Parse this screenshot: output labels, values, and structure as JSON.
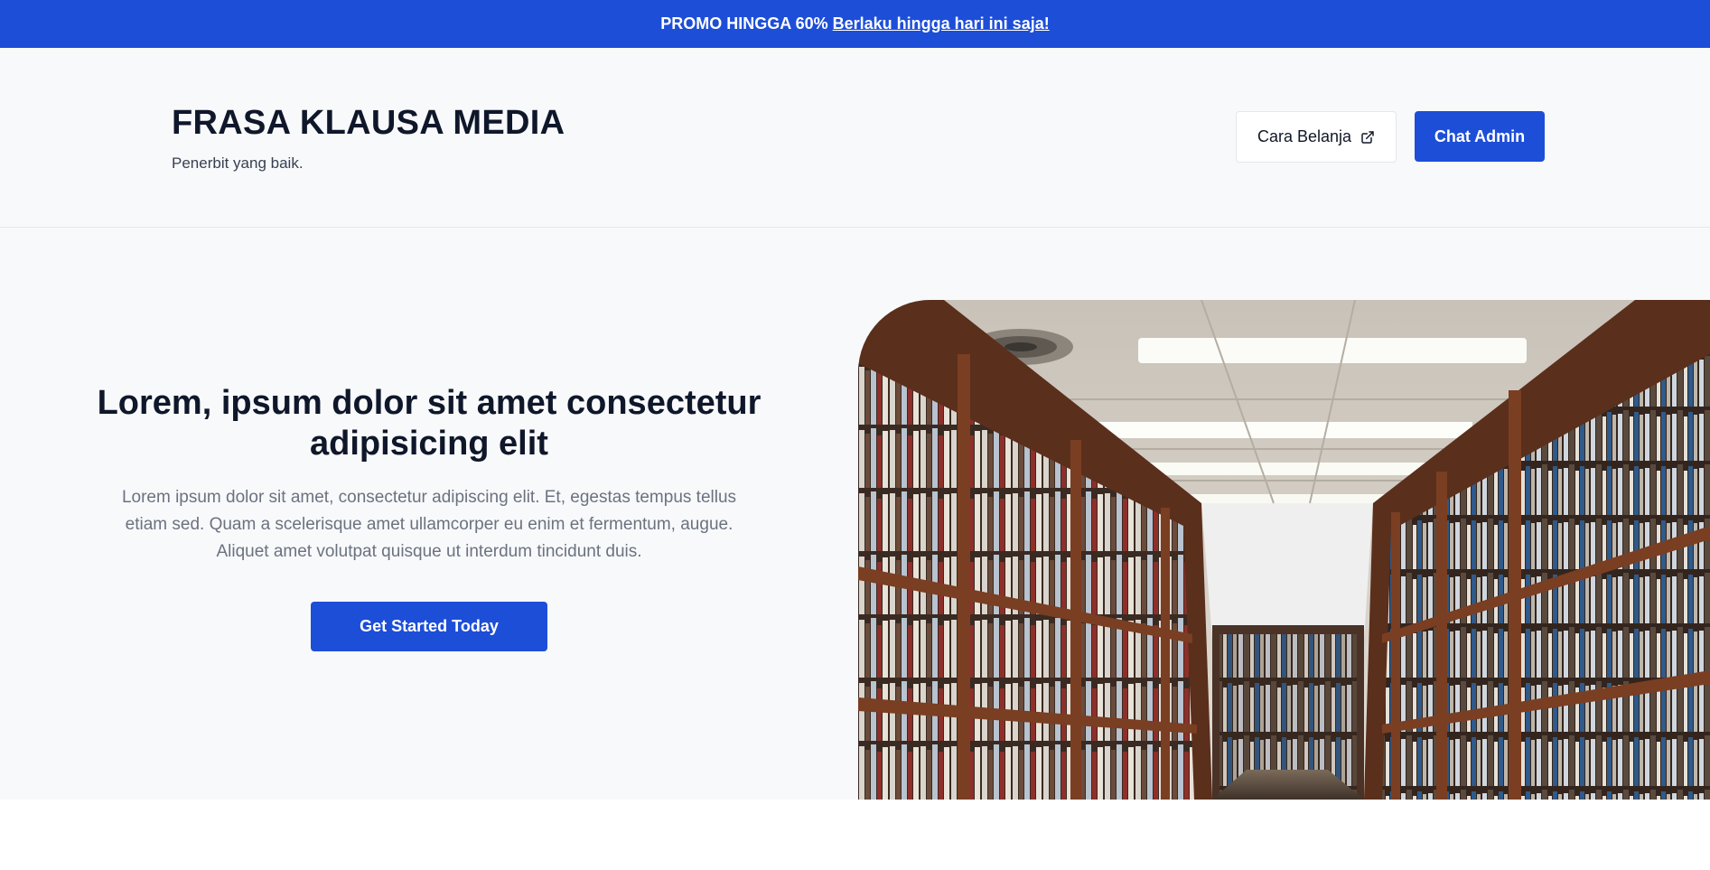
{
  "promo": {
    "text": "PROMO HINGGA 60%",
    "link": "Berlaku hingga hari ini saja!"
  },
  "header": {
    "title": "FRASA KLAUSA MEDIA",
    "subtitle": "Penerbit yang baik.",
    "cara_belanja_label": "Cara Belanja",
    "cara_belanja_icon": "external-link-icon",
    "chat_admin_label": "Chat Admin"
  },
  "hero": {
    "title": "Lorem, ipsum dolor sit amet consectetur adipisicing elit",
    "text": "Lorem ipsum dolor sit amet, consectetur adipiscing elit. Et, egestas tempus tellus etiam sed. Quam a scelerisque amet ullamcorper eu enim et fermentum, augue. Aliquet amet volutpat quisque ut interdum tincidunt duis.",
    "cta_label": "Get Started Today",
    "image_subject": "library-bookshelves-photo"
  },
  "colors": {
    "accent": "#1d4ed8",
    "background": "#f8f9fb",
    "heading": "#0f172a",
    "body_text": "#6b7280"
  }
}
